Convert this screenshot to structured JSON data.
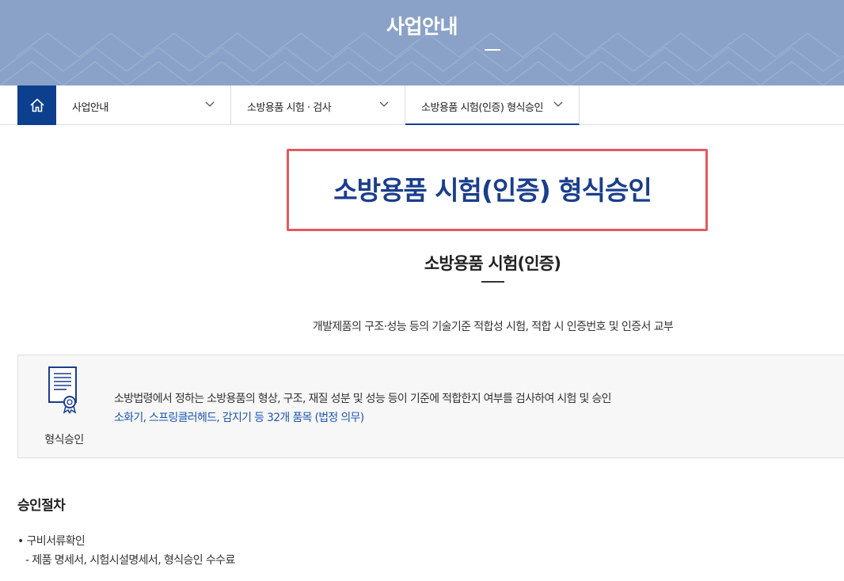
{
  "banner": {
    "title": "사업안내"
  },
  "subnav": {
    "home_icon": "home-icon",
    "items": [
      {
        "label": "사업안내"
      },
      {
        "label": "소방용품 시험 · 검사"
      },
      {
        "label": "소방용품 시험(인증) 형식승인"
      }
    ]
  },
  "page": {
    "title": "소방용품 시험(인증) 형식승인",
    "section_title": "소방용품 시험(인증)",
    "section_desc": "개발제품의 구조·성능 등의 기술기준 적합성 시험, 적합 시 인증번호 및 인증서 교부"
  },
  "info": {
    "icon": "certificate-icon",
    "label": "형식승인",
    "text1": "소방법령에서 정하는 소방용품의 형상, 구조, 재질 성분 및 성능 등이 기준에 적합한지 여부를 검사하여 시험 및 승인",
    "text2": "소화기, 스프링클러헤드, 감지기 등 32개 품목 (법정 의무)"
  },
  "procedure": {
    "title": "승인절차",
    "item": "• 구비서류확인",
    "sub": "- 제품 명세서, 시험시설명세서, 형식승인 수수료"
  },
  "colors": {
    "banner": "#8aa2c8",
    "primary": "#0d3f8f",
    "title_blue": "#1a3e8c",
    "highlight": "#e35a5f",
    "link_blue": "#1d56b0"
  }
}
